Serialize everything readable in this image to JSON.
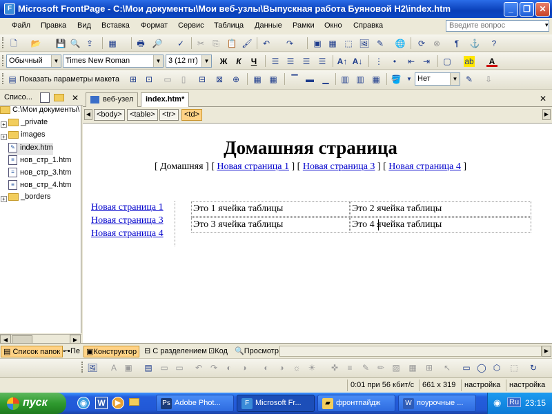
{
  "window": {
    "title": "Microsoft FrontPage - C:\\Мои документы\\Мои веб-узлы\\Выпускная работа Буяновой Н2\\index.htm",
    "btn_min": "_",
    "btn_max": "❐",
    "btn_close": "✕"
  },
  "menu": {
    "items": [
      "Файл",
      "Правка",
      "Вид",
      "Вставка",
      "Формат",
      "Сервис",
      "Таблица",
      "Данные",
      "Рамки",
      "Окно",
      "Справка"
    ],
    "ask_placeholder": "Введите вопрос"
  },
  "format_toolbar": {
    "style": "Обычный",
    "font": "Times New Roman",
    "size": "3  (12 пт)",
    "bold": "Ж",
    "italic": "К",
    "underline": "Ч"
  },
  "layout_toolbar": {
    "show_layout": "Показать параметры макета",
    "border_value": "Нет"
  },
  "folder_list": {
    "title": "Списо...",
    "close": "✕",
    "root": "C:\\Мои документы\\",
    "items": [
      "_private",
      "images",
      "index.htm",
      "нов_стр_1.htm",
      "нов_стр_3.htm",
      "нов_стр_4.htm",
      "_borders"
    ]
  },
  "doc_tabs": {
    "site_tab": "веб-узел",
    "file_tab": "index.htm*",
    "close": "✕"
  },
  "tags": [
    "<body>",
    "<table>",
    "<tr>",
    "<td>"
  ],
  "page": {
    "heading": "Домашняя страница",
    "nav": {
      "bracket_open": "[",
      "bracket_close": "]",
      "home": "Домашняя",
      "link1": "Новая страница 1",
      "link3": "Новая страница 3",
      "link4": "Новая страница 4"
    },
    "left_links": [
      "Новая страница 1",
      "Новая страница 3",
      "Новая страница 4"
    ],
    "table": [
      [
        "Это 1 ячейка таблицы",
        "Это 2 ячейка таблицы"
      ],
      [
        "Это 3 ячейка таблицы",
        "Это 4 ячейка таблицы"
      ]
    ]
  },
  "bottom_tabs": {
    "folder_list": "Список папок",
    "nav": "Пе",
    "design": "Конструктор",
    "split": "С разделением",
    "code": "Код",
    "preview": "Просмотр"
  },
  "status": {
    "download": "0:01 при 56 кбит/с",
    "dims": "661 x 319",
    "setting1": "настройка",
    "setting2": "настройка"
  },
  "taskbar": {
    "start": "пуск",
    "buttons": [
      "Adobe Phot...",
      "Microsoft Fr...",
      "фронтпайдж",
      "поурочные ..."
    ],
    "lang": "Ru",
    "time": "23:15"
  },
  "colors": {
    "titlebar": "#0A3FB8",
    "accent_selected": "#FFD285",
    "link": "#0000CC",
    "taskbar": "#245EDC",
    "start_green": "#2F9A2F"
  }
}
